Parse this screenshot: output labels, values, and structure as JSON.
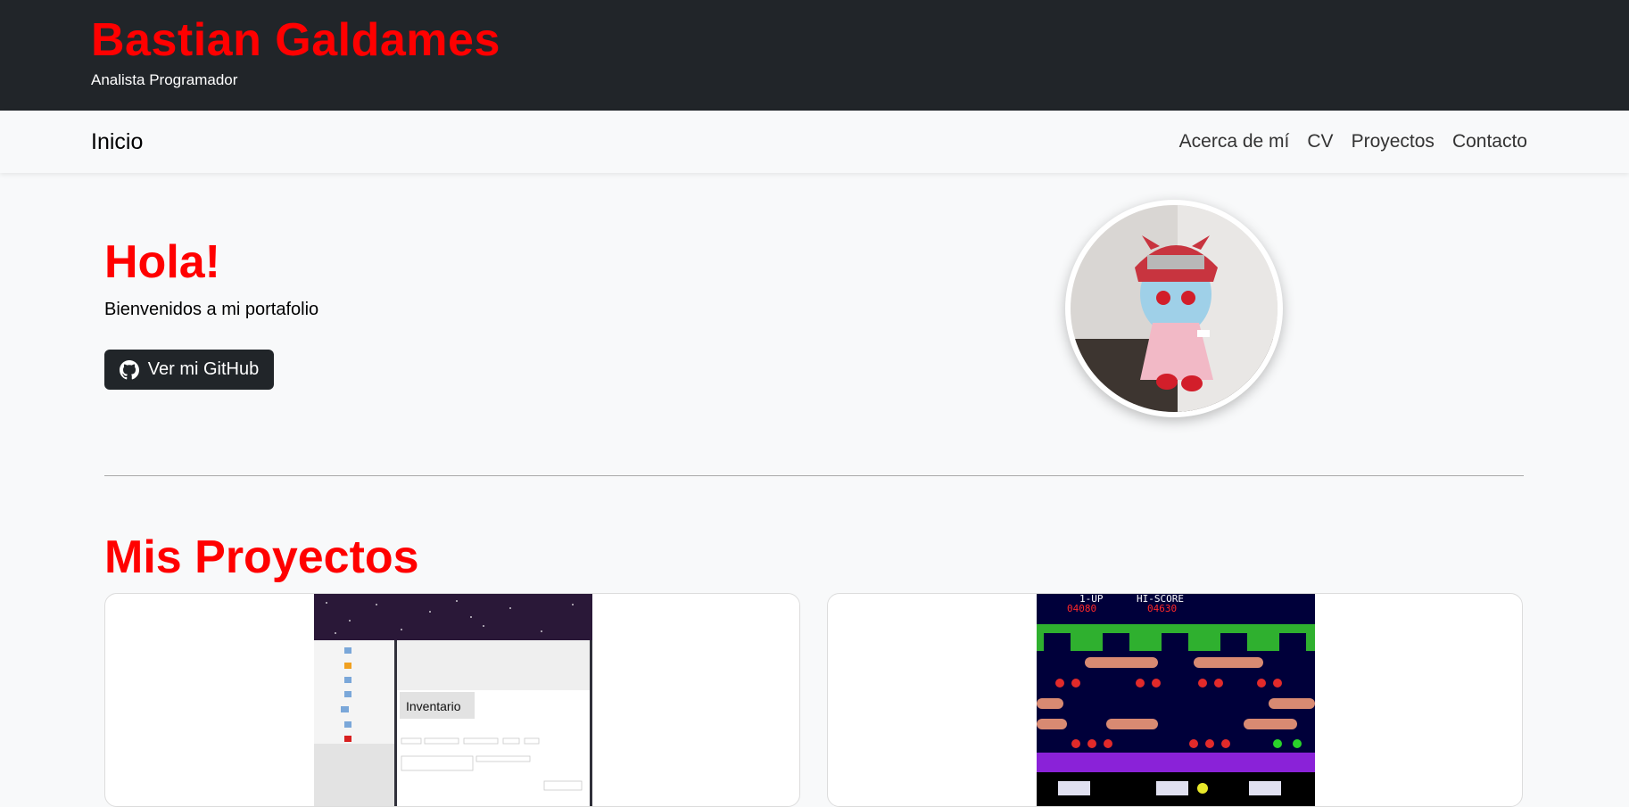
{
  "header": {
    "title": "Bastian Galdames",
    "subtitle": "Analista Programador"
  },
  "nav": {
    "home": "Inicio",
    "links": [
      "Acerca de mí",
      "CV",
      "Proyectos",
      "Contacto"
    ]
  },
  "hero": {
    "title": "Hola!",
    "text": "Bienvenidos a mi portafolio",
    "button_label": "Ver mi GitHub"
  },
  "projects": {
    "title": "Mis Proyectos",
    "inventory_heading": "Inventario",
    "frogger_hud": [
      "1-UP",
      "HI-SCORE",
      "04080",
      "04630"
    ]
  },
  "colors": {
    "accent": "#ff0000",
    "dark": "#212529",
    "bg": "#f8f9fa"
  }
}
